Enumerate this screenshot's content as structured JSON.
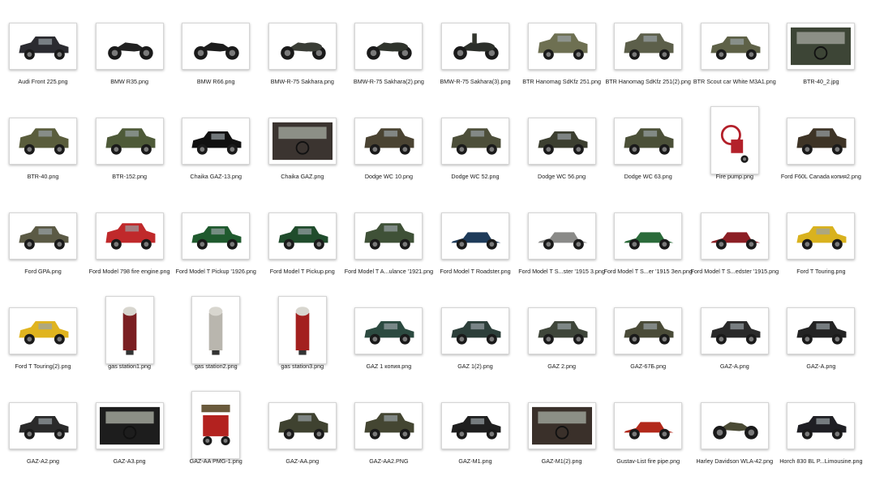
{
  "files": [
    {
      "name": "Audi Front 225.png",
      "icon": "vintage-sedan",
      "orient": "wide",
      "color": "#2b2b30"
    },
    {
      "name": "BMW R35.png",
      "icon": "motorcycle",
      "orient": "wide",
      "color": "#222222"
    },
    {
      "name": "BMW R66.png",
      "icon": "motorcycle",
      "orient": "wide",
      "color": "#1c1c1c"
    },
    {
      "name": "BMW-R-75 Sakhara.png",
      "icon": "sidecar-motorcycle",
      "orient": "wide",
      "color": "#3a3d36"
    },
    {
      "name": "BMW-R-75 Sakhara(2).png",
      "icon": "sidecar-motorcycle-trailer",
      "orient": "wide",
      "color": "#2f332c"
    },
    {
      "name": "BMW-R-75 Sakhara(3).png",
      "icon": "sidecar-motorcycle-rider",
      "orient": "wide",
      "color": "#2c2f2a"
    },
    {
      "name": "BTR Hanomag SdKfz 251.png",
      "icon": "armored-halftrack",
      "orient": "wide",
      "color": "#6e7052"
    },
    {
      "name": "BTR Hanomag SdKfz 251(2).png",
      "icon": "armored-halftrack",
      "orient": "wide",
      "color": "#5c5f4a"
    },
    {
      "name": "BTR Scout car White M3A1.png",
      "icon": "scout-car",
      "orient": "wide",
      "color": "#5e6147"
    },
    {
      "name": "BTR-40_2.jpg",
      "icon": "vehicle-interior",
      "orient": "wide",
      "color": "#3d4536"
    },
    {
      "name": "BTR-40.png",
      "icon": "armored-car",
      "orient": "wide",
      "color": "#5a5d3c"
    },
    {
      "name": "BTR-152.png",
      "icon": "armored-truck",
      "orient": "wide",
      "color": "#4e5a38"
    },
    {
      "name": "Chaika GAZ-13.png",
      "icon": "limousine",
      "orient": "wide",
      "color": "#111111"
    },
    {
      "name": "Chaika GAZ.png",
      "icon": "dashboard-interior",
      "orient": "wide",
      "color": "#3b3430"
    },
    {
      "name": "Dodge WC 10.png",
      "icon": "military-truck",
      "orient": "wide",
      "color": "#4a4332"
    },
    {
      "name": "Dodge WC 52.png",
      "icon": "military-truck",
      "orient": "wide",
      "color": "#4d4f3a"
    },
    {
      "name": "Dodge WC 56.png",
      "icon": "command-car",
      "orient": "wide",
      "color": "#3c3f30"
    },
    {
      "name": "Dodge WC 63.png",
      "icon": "military-truck",
      "orient": "wide",
      "color": "#4b5038"
    },
    {
      "name": "Fire pump.png",
      "icon": "fire-pump",
      "orient": "tall",
      "color": "#b3202a"
    },
    {
      "name": "Ford F60L Canada копия2.png",
      "icon": "military-truck",
      "orient": "wide",
      "color": "#3e3426"
    },
    {
      "name": "Ford GPA.png",
      "icon": "amphibious-jeep",
      "orient": "wide",
      "color": "#5b5a45"
    },
    {
      "name": "Ford Model 798 fire engine.png",
      "icon": "fire-engine",
      "orient": "wide",
      "color": "#c0292b"
    },
    {
      "name": "Ford Model T Pickup '1926.png",
      "icon": "vintage-pickup",
      "orient": "wide",
      "color": "#1f5a2e"
    },
    {
      "name": "Ford Model T Pickup.png",
      "icon": "vintage-pickup",
      "orient": "wide",
      "color": "#204c2c"
    },
    {
      "name": "Ford Model T A...ulance '1921.png",
      "icon": "vintage-ambulance",
      "orient": "wide",
      "color": "#3f5137"
    },
    {
      "name": "Ford Model T Roadster.png",
      "icon": "vintage-roadster",
      "orient": "wide",
      "color": "#1e3b5a"
    },
    {
      "name": "Ford Model T S...ster '1915 3.png",
      "icon": "vintage-speedster",
      "orient": "wide",
      "color": "#8a8a88"
    },
    {
      "name": "Ford Model T S...er '1915 Зел.png",
      "icon": "vintage-speedster",
      "orient": "wide",
      "color": "#2b6b3a"
    },
    {
      "name": "Ford Model T S...edster '1915.png",
      "icon": "vintage-speedster",
      "orient": "wide",
      "color": "#8c1f25"
    },
    {
      "name": "Ford T Touring.png",
      "icon": "vintage-touring-car",
      "orient": "wide",
      "color": "#d9b21e"
    },
    {
      "name": "Ford T Touring(2).png",
      "icon": "vintage-touring-car",
      "orient": "wide",
      "color": "#e0b41f"
    },
    {
      "name": "gas station1.png",
      "icon": "gas-pump",
      "orient": "tall",
      "color": "#7b1f22"
    },
    {
      "name": "gas station2.png",
      "icon": "gas-pump",
      "orient": "tall",
      "color": "#b9b6ae"
    },
    {
      "name": "gas station3.png",
      "icon": "gas-pump",
      "orient": "tall",
      "color": "#a3201f"
    },
    {
      "name": "GAZ 1 копия.png",
      "icon": "vintage-pickup",
      "orient": "wide",
      "color": "#2c4a40"
    },
    {
      "name": "GAZ 1(2).png",
      "icon": "vintage-pickup",
      "orient": "wide",
      "color": "#2d3f3a"
    },
    {
      "name": "GAZ 2.png",
      "icon": "vintage-sedan",
      "orient": "wide",
      "color": "#3f463a"
    },
    {
      "name": "GAZ-67Б.png",
      "icon": "military-jeep",
      "orient": "wide",
      "color": "#4a4b38"
    },
    {
      "name": "GAZ-A.png",
      "icon": "vintage-phaeton",
      "orient": "wide",
      "color": "#2a2a2a"
    },
    {
      "name": "GAZ-A.png",
      "icon": "vintage-phaeton",
      "orient": "wide",
      "color": "#232323"
    },
    {
      "name": "GAZ-A2.png",
      "icon": "vintage-phaeton",
      "orient": "wide",
      "color": "#2a2a2a"
    },
    {
      "name": "GAZ-A3.png",
      "icon": "vehicle-interior",
      "orient": "wide",
      "color": "#1d1d1d"
    },
    {
      "name": "GAZ-AA PMG-1.png",
      "icon": "fire-truck",
      "orient": "tall",
      "color": "#b3221f"
    },
    {
      "name": "GAZ-AA.png",
      "icon": "vintage-truck",
      "orient": "wide",
      "color": "#3f4230"
    },
    {
      "name": "GAZ-AA2.PNG",
      "icon": "vintage-truck",
      "orient": "wide",
      "color": "#444632"
    },
    {
      "name": "GAZ-M1.png",
      "icon": "vintage-sedan",
      "orient": "wide",
      "color": "#1f1f1f"
    },
    {
      "name": "GAZ-M1(2).png",
      "icon": "dashboard-interior",
      "orient": "wide",
      "color": "#3a302a"
    },
    {
      "name": "Gustav-List fire pipe.png",
      "icon": "fire-cart",
      "orient": "wide",
      "color": "#b2291b"
    },
    {
      "name": "Harley Davidson WLA-42.png",
      "icon": "motorcycle",
      "orient": "wide",
      "color": "#4a4a35"
    },
    {
      "name": "Horch 830 BL P...Limousine.png",
      "icon": "vintage-sedan",
      "orient": "wide",
      "color": "#1f1f24"
    }
  ]
}
